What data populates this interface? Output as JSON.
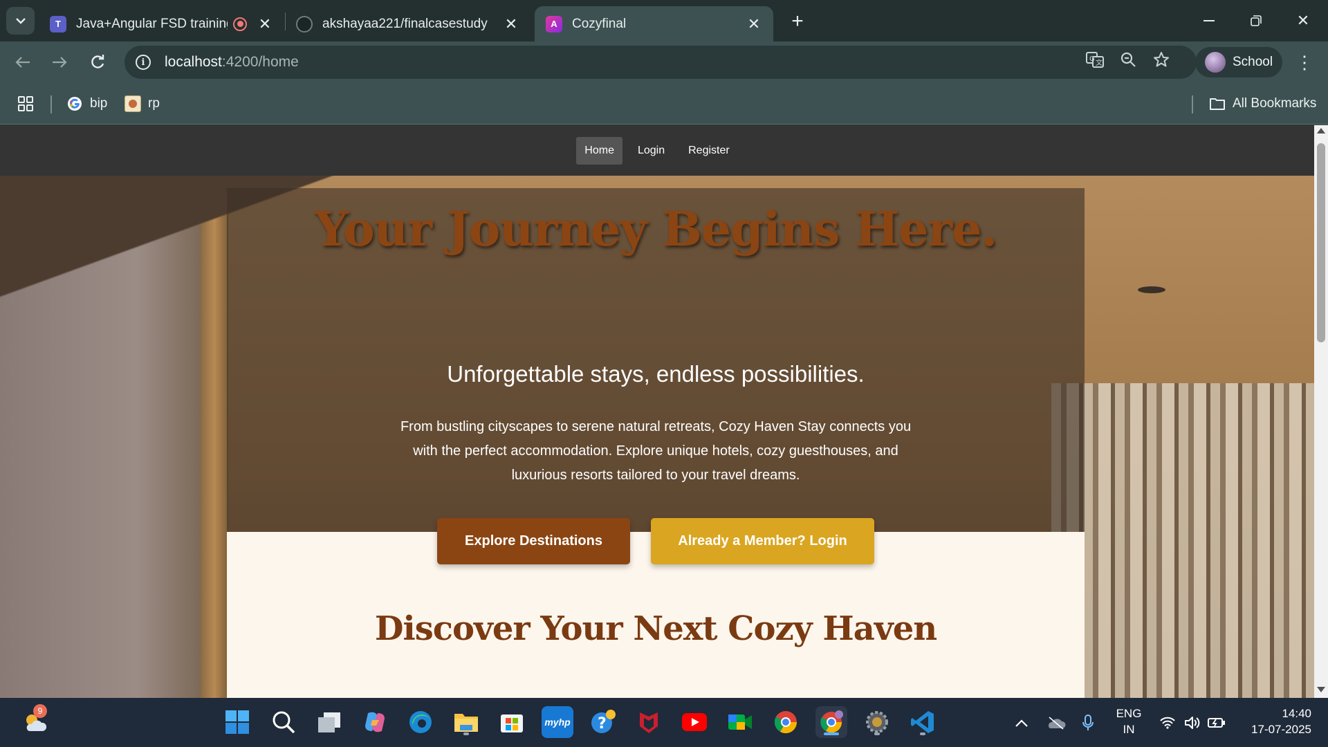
{
  "browser": {
    "tabs": [
      {
        "title": "Java+Angular FSD training -",
        "favicon": "teams-icon"
      },
      {
        "title": "akshayaa221/finalcasestudy",
        "favicon": "github-icon"
      },
      {
        "title": "Cozyfinal",
        "favicon": "angular-icon",
        "active": true
      }
    ],
    "url_host": "localhost",
    "url_rest": ":4200/home",
    "profile_label": "School",
    "bookmarks": [
      {
        "label": "bip",
        "icon": "google-icon"
      },
      {
        "label": "rp",
        "icon": "site-favicon"
      }
    ],
    "all_bookmarks_label": "All Bookmarks"
  },
  "site": {
    "nav": [
      {
        "label": "Home",
        "active": true
      },
      {
        "label": "Login"
      },
      {
        "label": "Register"
      }
    ],
    "hero": {
      "title": "Your Journey Begins Here.",
      "subtitle": "Unforgettable stays, endless possibilities.",
      "description": "From bustling cityscapes to serene natural retreats, Cozy Haven Stay connects you with the perfect accommodation. Explore unique hotels, cozy guesthouses, and luxurious resorts tailored to your travel dreams.",
      "primary_button": "Explore Destinations",
      "secondary_button": "Already a Member? Login"
    },
    "discover_title": "Discover Your Next Cozy Haven",
    "colors": {
      "brand_brown": "#8b4513",
      "brand_gold": "#daa520",
      "nav_bg": "#343434",
      "panel_bg": "#fdf6ec"
    }
  },
  "taskbar": {
    "weather_badge": "9",
    "language_top": "ENG",
    "language_bottom": "IN",
    "time": "14:40",
    "date": "17-07-2025",
    "apps": [
      "start-icon",
      "search-icon",
      "task-view-icon",
      "copilot-icon",
      "edge-icon",
      "file-explorer-icon",
      "store-icon",
      "myhp-icon",
      "get-help-icon",
      "mcafee-icon",
      "youtube-icon",
      "meet-icon",
      "chrome-icon",
      "chrome-profile-icon",
      "settings-icon",
      "vscode-icon"
    ]
  }
}
